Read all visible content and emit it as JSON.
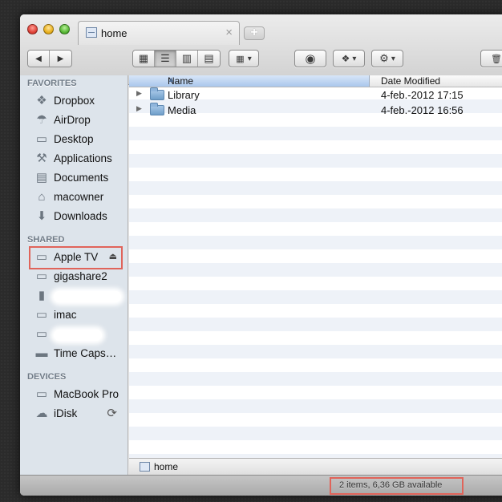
{
  "tab": {
    "label": "home",
    "close": "×",
    "new": "+"
  },
  "toolbar": {
    "back": "◀",
    "forward": "▶",
    "views": [
      "▦",
      "☰",
      "▥",
      "▤"
    ],
    "arrange": "▾",
    "quicklook": "◉",
    "dropbox": "▾",
    "action": "▾",
    "trash": "🗑"
  },
  "sidebar": {
    "favorites_header": "FAVORITES",
    "favorites": [
      {
        "label": "Dropbox",
        "icon": "dropbox-icon"
      },
      {
        "label": "AirDrop",
        "icon": "airdrop-icon"
      },
      {
        "label": "Desktop",
        "icon": "desktop-icon"
      },
      {
        "label": "Applications",
        "icon": "applications-icon"
      },
      {
        "label": "Documents",
        "icon": "documents-icon"
      },
      {
        "label": "macowner",
        "icon": "home-icon"
      },
      {
        "label": "Downloads",
        "icon": "downloads-icon"
      }
    ],
    "shared_header": "SHARED",
    "shared": [
      {
        "label": "Apple TV",
        "icon": "display-icon",
        "eject": "⏏"
      },
      {
        "label": "gigashare2",
        "icon": "display-icon"
      },
      {
        "label": "",
        "icon": "device-icon"
      },
      {
        "label": "imac",
        "icon": "display-icon"
      },
      {
        "label": "",
        "icon": "display-icon"
      },
      {
        "label": "Time Caps…",
        "icon": "time-capsule-icon"
      }
    ],
    "devices_header": "DEVICES",
    "devices": [
      {
        "label": "MacBook Pro",
        "icon": "laptop-icon"
      },
      {
        "label": "iDisk",
        "icon": "idisk-icon",
        "sync": "⟳"
      }
    ]
  },
  "columns": {
    "name": "Name",
    "date": "Date Modified",
    "sort": "▲"
  },
  "rows": [
    {
      "name": "Library",
      "date": "4-feb.-2012 17:15"
    },
    {
      "name": "Media",
      "date": "4-feb.-2012 16:56"
    }
  ],
  "pathbar": {
    "label": "home"
  },
  "status": {
    "text": "2 items, 6,36 GB available"
  },
  "colors": {
    "highlight": "#e0645a",
    "sidebar": "#dde4eb",
    "selected_column": "#a9c6ec"
  }
}
